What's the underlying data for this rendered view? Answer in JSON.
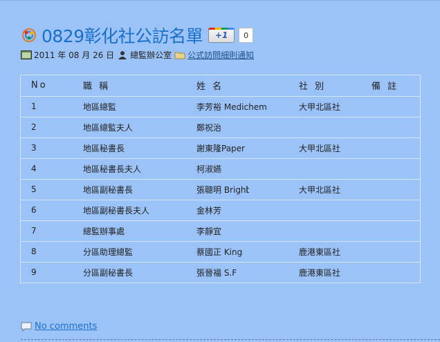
{
  "post": {
    "title": "0829彰化社公訪名單",
    "plusone_label": "+1",
    "plusone_count": "0",
    "date": "2011 年 08 月 26 日",
    "author": "總監辦公室",
    "category": "公式訪問細則通知"
  },
  "table": {
    "headers": [
      "No",
      "職 稱",
      "姓 名",
      "社 別",
      "備 註"
    ],
    "rows": [
      [
        "1",
        "地區總監",
        "李芳裕 Medichem",
        "大甲北區社",
        ""
      ],
      [
        "2",
        "地區總監夫人",
        "鄭祝治",
        "",
        ""
      ],
      [
        "3",
        "地區秘書長",
        "謝東隆Paper",
        "大甲北區社",
        ""
      ],
      [
        "4",
        "地區秘書長夫人",
        "柯淑嬿",
        "",
        ""
      ],
      [
        "5",
        "地區副秘書長",
        "張聰明 Bright",
        "大甲北區社",
        ""
      ],
      [
        "6",
        "地區副秘書長夫人",
        "金林芳",
        "",
        ""
      ],
      [
        "7",
        "總監辦事處",
        "李靜宜",
        "",
        ""
      ],
      [
        "8",
        "分區助理總監",
        "蔡國正 King",
        "鹿港東區社",
        ""
      ],
      [
        "9",
        "分區副秘書長",
        "張晉福 S.F",
        "鹿港東區社",
        ""
      ]
    ]
  },
  "footer": {
    "comments_label": "No comments"
  },
  "colors": {
    "background": "#9cc3f7",
    "title": "#1a6fc9",
    "link": "#1d6fd0"
  }
}
